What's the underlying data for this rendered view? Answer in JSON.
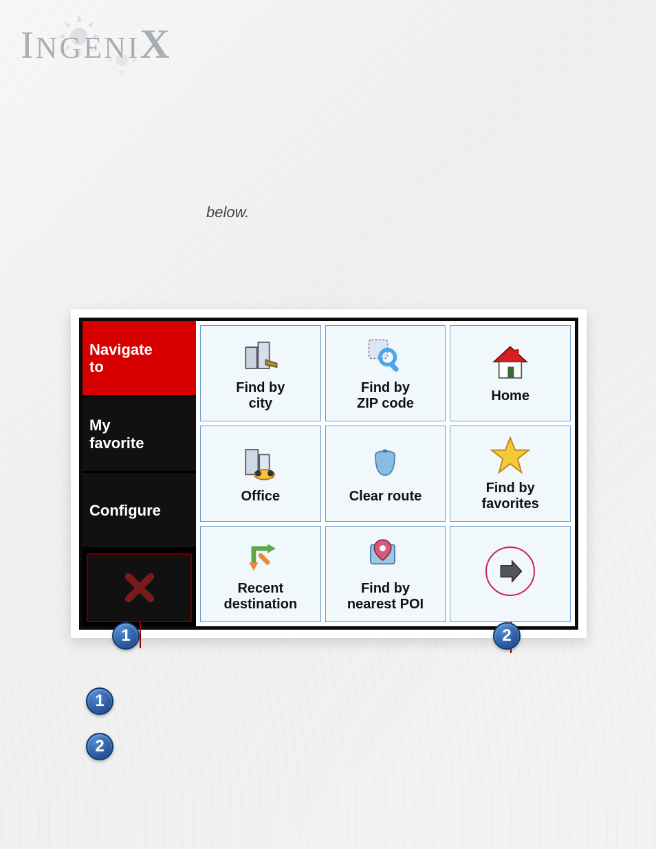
{
  "brand": "INGENIX",
  "intro_text": "below.",
  "sidebar": {
    "items": [
      {
        "label": "Navigate\nto",
        "active": true
      },
      {
        "label": "My\nfavorite",
        "active": false
      },
      {
        "label": "Configure",
        "active": false
      }
    ],
    "close_name": "close"
  },
  "grid": {
    "tiles": [
      {
        "icon": "city",
        "label": "Find by\ncity"
      },
      {
        "icon": "zip",
        "label": "Find by\nZIP code"
      },
      {
        "icon": "home",
        "label": "Home"
      },
      {
        "icon": "office",
        "label": "Office"
      },
      {
        "icon": "clear",
        "label": "Clear route"
      },
      {
        "icon": "star",
        "label": "Find by\nfavorites"
      },
      {
        "icon": "recent",
        "label": "Recent\ndestination"
      },
      {
        "icon": "poi",
        "label": "Find by\nnearest POI"
      },
      {
        "icon": "next-arrow",
        "label": ""
      }
    ]
  },
  "callouts": {
    "b1": "1",
    "b2": "2"
  },
  "legend": [
    {
      "num": "1",
      "text": ""
    },
    {
      "num": "2",
      "text": ""
    }
  ],
  "page_number": ""
}
